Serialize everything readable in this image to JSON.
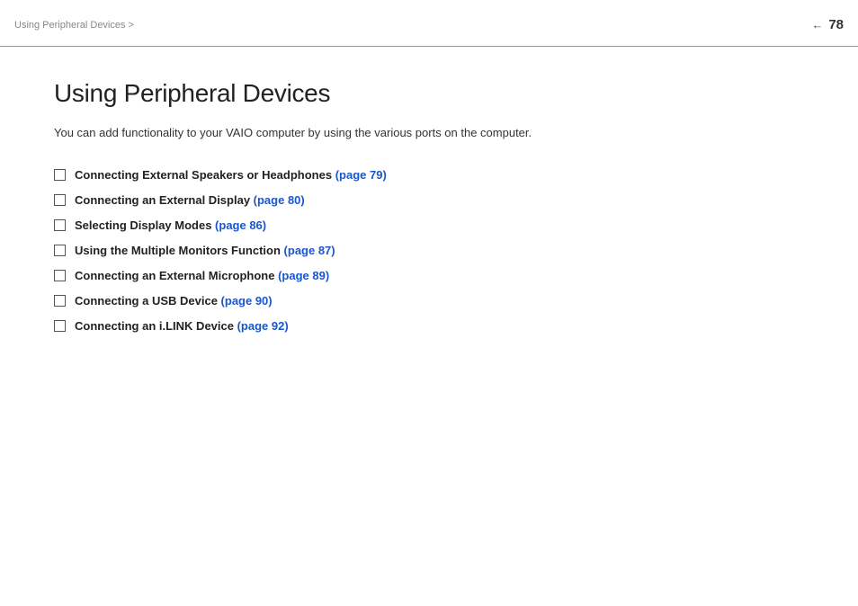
{
  "header": {
    "breadcrumb": "Using Peripheral Devices >",
    "page_number": "78",
    "arrow": "←"
  },
  "main": {
    "title": "Using Peripheral Devices",
    "intro": "You can add functionality to your VAIO computer by using the various ports on the computer.",
    "toc_items": [
      {
        "id": "item-1",
        "label": "Connecting External Speakers or Headphones ",
        "link_text": "(page 79)",
        "link_href": "#page79"
      },
      {
        "id": "item-2",
        "label": "Connecting an External Display ",
        "link_text": "(page 80)",
        "link_href": "#page80"
      },
      {
        "id": "item-3",
        "label": "Selecting Display Modes ",
        "link_text": "(page 86)",
        "link_href": "#page86"
      },
      {
        "id": "item-4",
        "label": "Using the Multiple Monitors Function ",
        "link_text": "(page 87)",
        "link_href": "#page87"
      },
      {
        "id": "item-5",
        "label": "Connecting an External Microphone ",
        "link_text": "(page 89)",
        "link_href": "#page89"
      },
      {
        "id": "item-6",
        "label": "Connecting a USB Device ",
        "link_text": "(page 90)",
        "link_href": "#page90"
      },
      {
        "id": "item-7",
        "label": "Connecting an i.LINK Device ",
        "link_text": "(page 92)",
        "link_href": "#page92"
      }
    ]
  }
}
